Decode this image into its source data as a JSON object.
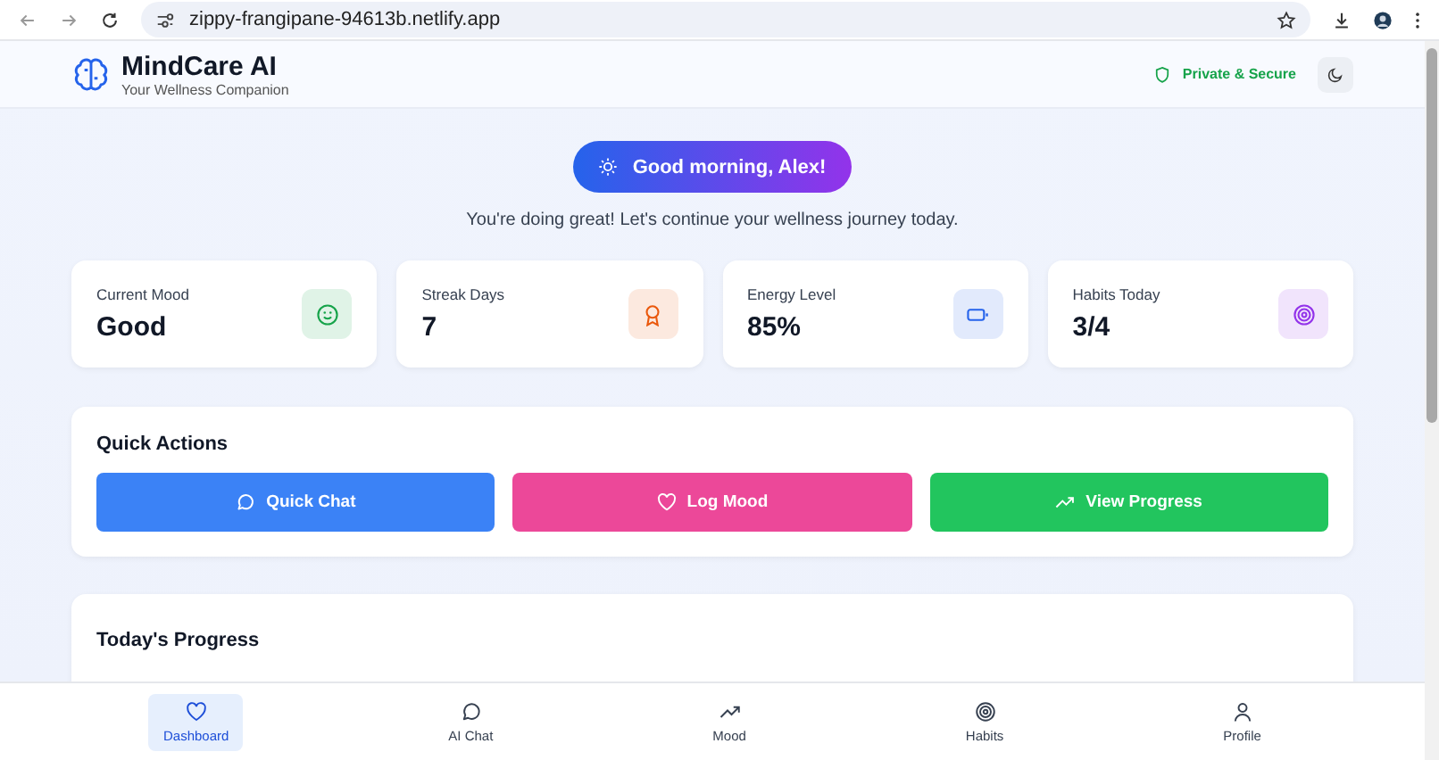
{
  "browser": {
    "url": "zippy-frangipane-94613b.netlify.app"
  },
  "header": {
    "title": "MindCare AI",
    "subtitle": "Your Wellness Companion",
    "badge": "Private & Secure"
  },
  "greeting": {
    "label": "Good morning, Alex!",
    "message": "You're doing great! Let's continue your wellness journey today."
  },
  "stats": [
    {
      "label": "Current Mood",
      "value": "Good",
      "color": "#16a34a"
    },
    {
      "label": "Streak Days",
      "value": "7",
      "color": "#ea580c"
    },
    {
      "label": "Energy Level",
      "value": "85%",
      "color": "#2563eb"
    },
    {
      "label": "Habits Today",
      "value": "3/4",
      "color": "#9333ea"
    }
  ],
  "quick_actions": {
    "title": "Quick Actions",
    "buttons": [
      {
        "label": "Quick Chat",
        "color": "#3b82f6"
      },
      {
        "label": "Log Mood",
        "color": "#ec4899"
      },
      {
        "label": "View Progress",
        "color": "#22c55e"
      }
    ]
  },
  "progress": {
    "title": "Today's Progress"
  },
  "nav": [
    {
      "label": "Dashboard",
      "selected": true
    },
    {
      "label": "AI Chat",
      "selected": false
    },
    {
      "label": "Mood",
      "selected": false
    },
    {
      "label": "Habits",
      "selected": false
    },
    {
      "label": "Profile",
      "selected": false
    }
  ]
}
